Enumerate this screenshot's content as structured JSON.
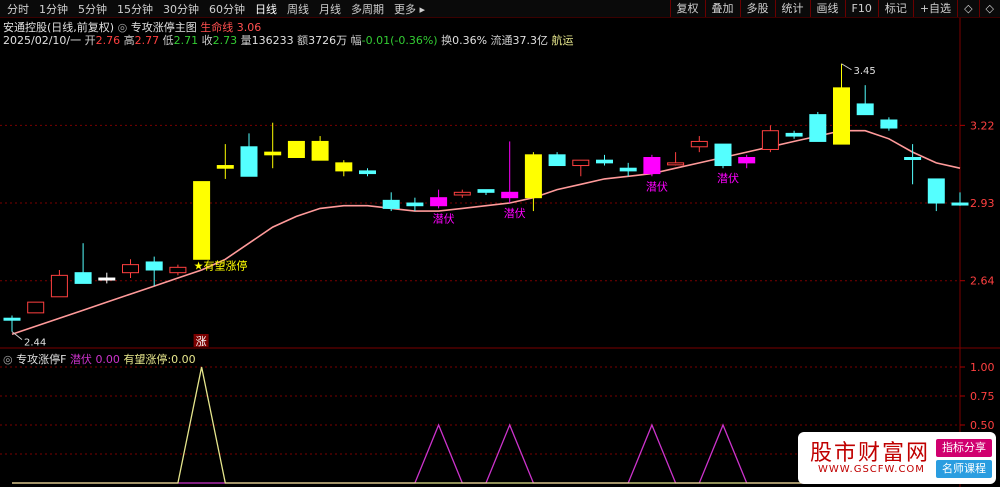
{
  "toolbar": {
    "left": [
      "分时",
      "1分钟",
      "5分钟",
      "15分钟",
      "30分钟",
      "60分钟",
      "日线",
      "周线",
      "月线",
      "多周期",
      "更多 ▸"
    ],
    "active": "日线",
    "right": [
      "复权",
      "叠加",
      "多股",
      "统计",
      "画线",
      "F10",
      "标记",
      "+自选",
      "◇",
      "◇"
    ]
  },
  "header": {
    "stock": "安通控股(日线,前复权)",
    "indicator": "专攻涨停主图",
    "life_label": "生命线",
    "life_value": "3.06",
    "date": "2025/02/10/一",
    "open_label": "开",
    "open": "2.76",
    "high_label": "高",
    "high": "2.77",
    "low_label": "低",
    "low": "2.71",
    "close_label": "收",
    "close": "2.73",
    "vol_label": "量",
    "vol": "136233",
    "amount_label": "额",
    "amount": "3726万",
    "change_label": "幅",
    "change": "-0.01(-0.36%)",
    "turnover_label": "换",
    "turnover": "0.36%",
    "float_label": "流通",
    "float": "37.3亿",
    "sector": "航运"
  },
  "sub_header": {
    "name": "专攻涨停F",
    "s1_label": "潜伏",
    "s1_value": "0.00",
    "s2_label": "有望涨停",
    "s2_value": "0.00"
  },
  "chart_data": [
    {
      "type": "candlestick",
      "y_ticks": [
        "3.22",
        "2.93",
        "2.64"
      ],
      "y_tick_values": [
        3.22,
        2.93,
        2.64
      ],
      "high_label": "3.45",
      "low_label": "2.44",
      "candles": [
        {
          "o": 2.5,
          "h": 2.51,
          "l": 2.45,
          "c": 2.5,
          "color": "cyan"
        },
        {
          "o": 2.52,
          "h": 2.56,
          "l": 2.52,
          "c": 2.56,
          "color": "red"
        },
        {
          "o": 2.58,
          "h": 2.68,
          "l": 2.58,
          "c": 2.66,
          "color": "red"
        },
        {
          "o": 2.67,
          "h": 2.78,
          "l": 2.67,
          "c": 2.63,
          "color": "cyan"
        },
        {
          "o": 2.65,
          "h": 2.67,
          "l": 2.63,
          "c": 2.65,
          "color": "white"
        },
        {
          "o": 2.67,
          "h": 2.72,
          "l": 2.65,
          "c": 2.7,
          "color": "red"
        },
        {
          "o": 2.71,
          "h": 2.73,
          "l": 2.62,
          "c": 2.68,
          "color": "cyan"
        },
        {
          "o": 2.67,
          "h": 2.7,
          "l": 2.66,
          "c": 2.69,
          "color": "red"
        },
        {
          "o": 2.72,
          "h": 3.01,
          "l": 2.72,
          "c": 3.01,
          "color": "yellow"
        },
        {
          "o": 3.06,
          "h": 3.15,
          "l": 3.02,
          "c": 3.07,
          "color": "yellow"
        },
        {
          "o": 3.14,
          "h": 3.19,
          "l": 3.03,
          "c": 3.03,
          "color": "cyan"
        },
        {
          "o": 3.11,
          "h": 3.23,
          "l": 3.06,
          "c": 3.12,
          "color": "yellow"
        },
        {
          "o": 3.1,
          "h": 3.16,
          "l": 3.1,
          "c": 3.16,
          "color": "yellow"
        },
        {
          "o": 3.16,
          "h": 3.18,
          "l": 3.09,
          "c": 3.09,
          "color": "yellow"
        },
        {
          "o": 3.08,
          "h": 3.09,
          "l": 3.03,
          "c": 3.05,
          "color": "yellow"
        },
        {
          "o": 3.05,
          "h": 3.06,
          "l": 3.03,
          "c": 3.04,
          "color": "cyan"
        },
        {
          "o": 2.94,
          "h": 2.97,
          "l": 2.9,
          "c": 2.91,
          "color": "cyan"
        },
        {
          "o": 2.92,
          "h": 2.95,
          "l": 2.9,
          "c": 2.93,
          "color": "cyan"
        },
        {
          "o": 2.92,
          "h": 2.98,
          "l": 2.91,
          "c": 2.95,
          "color": "magenta"
        },
        {
          "o": 2.96,
          "h": 2.98,
          "l": 2.95,
          "c": 2.97,
          "color": "red"
        },
        {
          "o": 2.98,
          "h": 2.98,
          "l": 2.96,
          "c": 2.97,
          "color": "cyan"
        },
        {
          "o": 2.97,
          "h": 3.16,
          "l": 2.93,
          "c": 2.95,
          "color": "magenta"
        },
        {
          "o": 2.95,
          "h": 3.12,
          "l": 2.9,
          "c": 3.11,
          "color": "yellow"
        },
        {
          "o": 3.11,
          "h": 3.12,
          "l": 3.07,
          "c": 3.07,
          "color": "cyan"
        },
        {
          "o": 3.07,
          "h": 3.09,
          "l": 3.03,
          "c": 3.09,
          "color": "red"
        },
        {
          "o": 3.09,
          "h": 3.11,
          "l": 3.07,
          "c": 3.08,
          "color": "cyan"
        },
        {
          "o": 3.06,
          "h": 3.08,
          "l": 3.03,
          "c": 3.05,
          "color": "cyan"
        },
        {
          "o": 3.1,
          "h": 3.11,
          "l": 3.03,
          "c": 3.04,
          "color": "magenta"
        },
        {
          "o": 3.08,
          "h": 3.12,
          "l": 3.07,
          "c": 3.08,
          "color": "red"
        },
        {
          "o": 3.14,
          "h": 3.18,
          "l": 3.12,
          "c": 3.16,
          "color": "red"
        },
        {
          "o": 3.15,
          "h": 3.15,
          "l": 3.06,
          "c": 3.07,
          "color": "cyan"
        },
        {
          "o": 3.1,
          "h": 3.11,
          "l": 3.06,
          "c": 3.08,
          "color": "magenta"
        },
        {
          "o": 3.13,
          "h": 3.22,
          "l": 3.12,
          "c": 3.2,
          "color": "red"
        },
        {
          "o": 3.19,
          "h": 3.2,
          "l": 3.17,
          "c": 3.18,
          "color": "cyan"
        },
        {
          "o": 3.26,
          "h": 3.27,
          "l": 3.16,
          "c": 3.16,
          "color": "cyan"
        },
        {
          "o": 3.36,
          "h": 3.45,
          "l": 3.15,
          "c": 3.15,
          "color": "yellow"
        },
        {
          "o": 3.3,
          "h": 3.37,
          "l": 3.26,
          "c": 3.26,
          "color": "cyan"
        },
        {
          "o": 3.24,
          "h": 3.25,
          "l": 3.2,
          "c": 3.21,
          "color": "cyan"
        },
        {
          "o": 3.1,
          "h": 3.15,
          "l": 3.0,
          "c": 3.1,
          "color": "cyan"
        },
        {
          "o": 3.02,
          "h": 3.02,
          "l": 2.9,
          "c": 2.93,
          "color": "cyan"
        },
        {
          "o": 2.93,
          "h": 2.97,
          "l": 2.92,
          "c": 2.93,
          "color": "cyan"
        }
      ],
      "life_line": [
        2.44,
        2.47,
        2.5,
        2.53,
        2.56,
        2.59,
        2.62,
        2.65,
        2.68,
        2.72,
        2.78,
        2.84,
        2.88,
        2.91,
        2.92,
        2.92,
        2.91,
        2.9,
        2.9,
        2.91,
        2.92,
        2.93,
        2.95,
        2.98,
        3.0,
        3.02,
        3.03,
        3.04,
        3.06,
        3.08,
        3.1,
        3.12,
        3.14,
        3.16,
        3.18,
        3.2,
        3.2,
        3.17,
        3.12,
        3.08,
        3.06
      ],
      "signals": [
        {
          "index": 8,
          "label": "有望涨停",
          "color": "yellow"
        },
        {
          "index": 18,
          "label": "潜伏",
          "color": "magenta"
        },
        {
          "index": 21,
          "label": "潜伏",
          "color": "magenta"
        },
        {
          "index": 27,
          "label": "潜伏",
          "color": "magenta"
        },
        {
          "index": 30,
          "label": "潜伏",
          "color": "magenta"
        }
      ],
      "zhang_label": "涨"
    },
    {
      "type": "line",
      "y_ticks": [
        "1.00",
        "0.75",
        "0.50",
        "0.25"
      ],
      "y_tick_values": [
        1.0,
        0.75,
        0.5,
        0.25
      ],
      "series": [
        {
          "name": "潜伏",
          "color": "#cc33cc",
          "peaks": [
            18,
            21,
            27,
            30
          ]
        },
        {
          "name": "有望涨停",
          "color": "#e6e68c",
          "peaks": [
            8
          ]
        }
      ]
    }
  ],
  "watermark": {
    "title": "股市财富网",
    "url": "WWW.GSCFW.COM",
    "tag1": "指标分享",
    "tag2": "名师课程"
  }
}
